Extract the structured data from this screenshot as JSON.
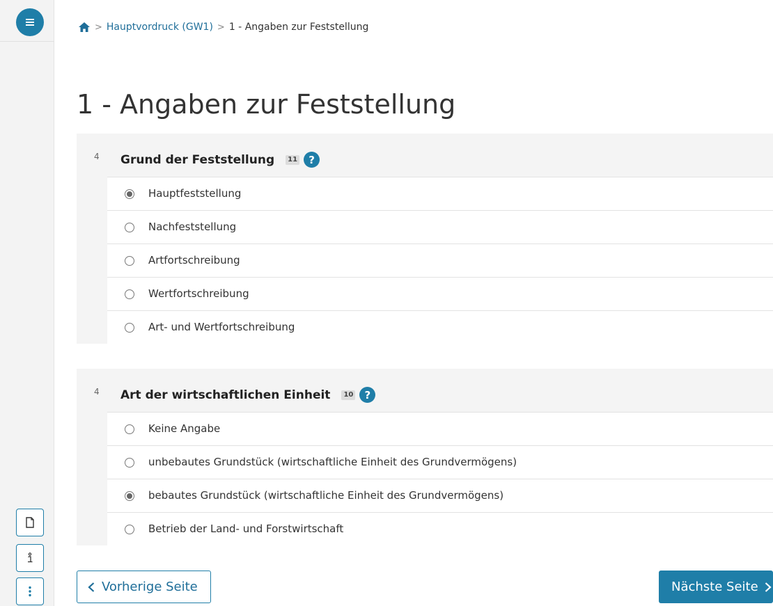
{
  "breadcrumb": {
    "home_icon": "home-icon",
    "items": [
      "Hauptvordruck (GW1)",
      "1 - Angaben zur Feststellung"
    ]
  },
  "page_title": "1 - Angaben zur Feststellung",
  "sections": [
    {
      "line_no": "4",
      "title": "Grund der Feststellung",
      "field_no": "11",
      "help": "?",
      "options": [
        {
          "label": "Hauptfeststellung",
          "checked": true
        },
        {
          "label": "Nachfeststellung",
          "checked": false
        },
        {
          "label": "Artfortschreibung",
          "checked": false
        },
        {
          "label": "Wertfortschreibung",
          "checked": false
        },
        {
          "label": "Art- und Wertfortschreibung",
          "checked": false
        }
      ]
    },
    {
      "line_no": "4",
      "title": "Art der wirtschaftlichen Einheit",
      "field_no": "10",
      "help": "?",
      "options": [
        {
          "label": "Keine Angabe",
          "checked": false
        },
        {
          "label": "unbebautes Grundstück (wirtschaftliche Einheit des Grundvermögens)",
          "checked": false
        },
        {
          "label": "bebautes Grundstück (wirtschaftliche Einheit des Grundvermögens)",
          "checked": true
        },
        {
          "label": "Betrieb der Land- und Forstwirtschaft",
          "checked": false
        }
      ]
    }
  ],
  "nav": {
    "prev_label": "Vorherige Seite",
    "next_label": "Nächste Seite"
  },
  "rail_icons": [
    "menu-icon",
    "document-icon",
    "info-icon",
    "more-icon"
  ],
  "colors": {
    "accent": "#1f7ea8",
    "link": "#1f6e99",
    "section_bg": "#f4f4f4"
  }
}
